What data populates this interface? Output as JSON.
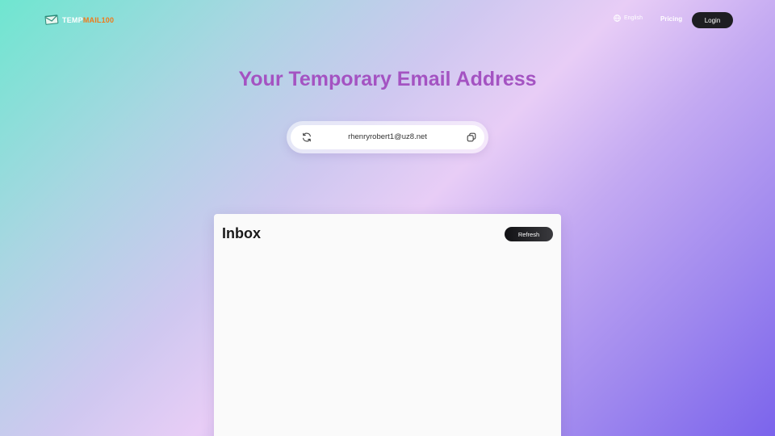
{
  "header": {
    "logo": {
      "part1": "TEMP",
      "part2": "MAIL100",
      "icon": "envelope-icon"
    },
    "language": {
      "label": "English",
      "icon": "globe-icon"
    },
    "pricing_label": "Pricing",
    "login_label": "Login"
  },
  "main": {
    "title": "Your Temporary Email Address",
    "email": {
      "address": "rhenryrobert1@uz8.net",
      "refresh_icon": "refresh-icon",
      "copy_icon": "copy-icon"
    }
  },
  "inbox": {
    "title": "Inbox",
    "refresh_label": "Refresh",
    "messages": []
  },
  "colors": {
    "title": "#a453c2",
    "logo_accent": "#f07a1a",
    "button_dark": "#1e1e22"
  }
}
